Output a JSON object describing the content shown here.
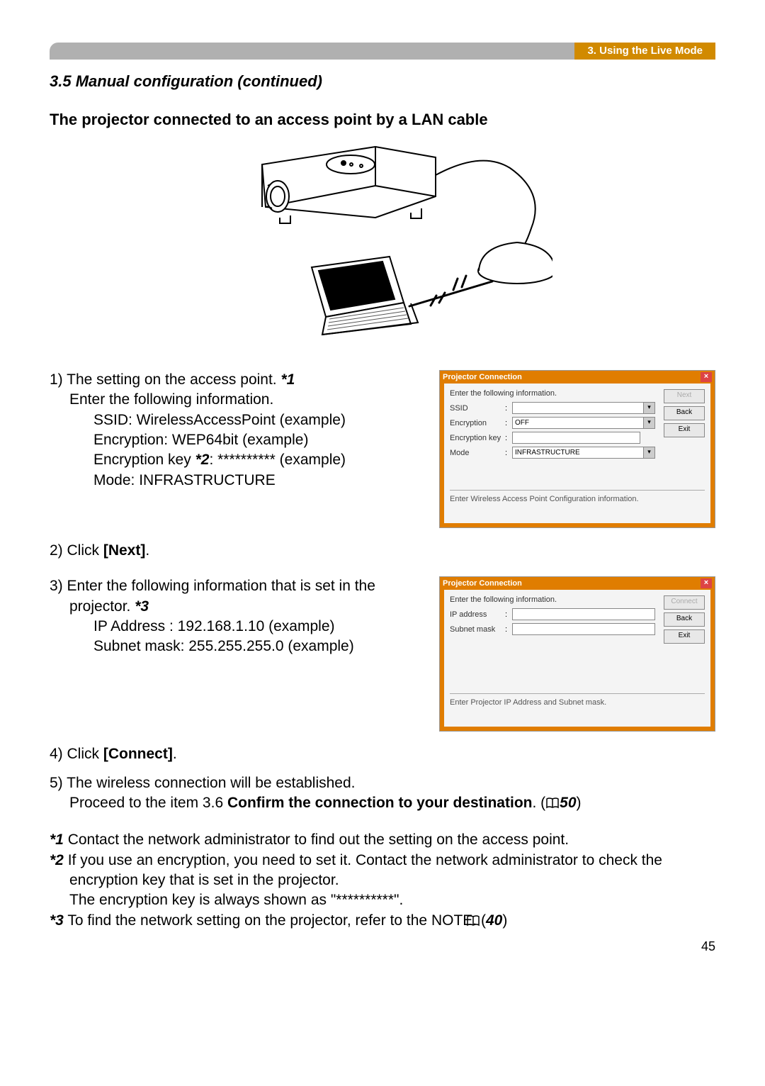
{
  "header_label": "3. Using the Live Mode",
  "section_title": "3.5 Manual configuration (continued)",
  "sub_head": "The projector connected to an access point by a LAN cable",
  "step1": {
    "line": "1) The setting on the access point. ",
    "fn": "*1",
    "line2": "Enter the following information.",
    "d1": "SSID: WirelessAccessPoint (example)",
    "d2": "Encryption: WEP64bit (example)",
    "d3a": "Encryption key ",
    "d3fn": "*2",
    "d3b": ": ********** (example)",
    "d4": "Mode: INFRASTRUCTURE"
  },
  "step2": {
    "a": "2) Click ",
    "b": "[Next]",
    "c": "."
  },
  "step3": {
    "line": "3) Enter the following information that is set in the projector. ",
    "fn": "*3",
    "d1": "IP Address : 192.168.1.10 (example)",
    "d2": "Subnet mask: 255.255.255.0 (example)"
  },
  "step4": {
    "a": "4) Click ",
    "b": "[Connect]",
    "c": "."
  },
  "step5": {
    "line1": "5) The wireless connection will be established.",
    "line2a": "Proceed to the item 3.6 ",
    "line2b": "Confirm the connection to your destination",
    "line2c": ". (",
    "ref": "50",
    "line2d": ")"
  },
  "fn1": {
    "lab": "*1",
    "txt": " Contact the network administrator to find out the setting on the access point."
  },
  "fn2": {
    "lab": "*2",
    "pre": " If you use an encryption, you need to set it. Contact the network administrator to check the encryption key that is set in the projector.",
    "line2": "The encryption key is always shown as \"**********\"."
  },
  "fn3": {
    "lab": "*3",
    "txt": " To find the network setting on the projector, refer to the NOTE. (",
    "ref": "40",
    "tail": ")"
  },
  "page_num": "45",
  "dlg1": {
    "title": "Projector Connection",
    "instr": "Enter the following information.",
    "ssid_lab": "SSID",
    "enc_lab": "Encryption",
    "enc_val": "OFF",
    "key_lab": "Encryption key",
    "mode_lab": "Mode",
    "mode_val": "INFRASTRUCTURE",
    "next": "Next",
    "back": "Back",
    "exit": "Exit",
    "status": "Enter Wireless Access Point Configuration information."
  },
  "dlg2": {
    "title": "Projector Connection",
    "instr": "Enter the following information.",
    "ip_lab": "IP address",
    "mask_lab": "Subnet mask",
    "connect": "Connect",
    "back": "Back",
    "exit": "Exit",
    "status": "Enter Projector IP Address and Subnet mask."
  }
}
